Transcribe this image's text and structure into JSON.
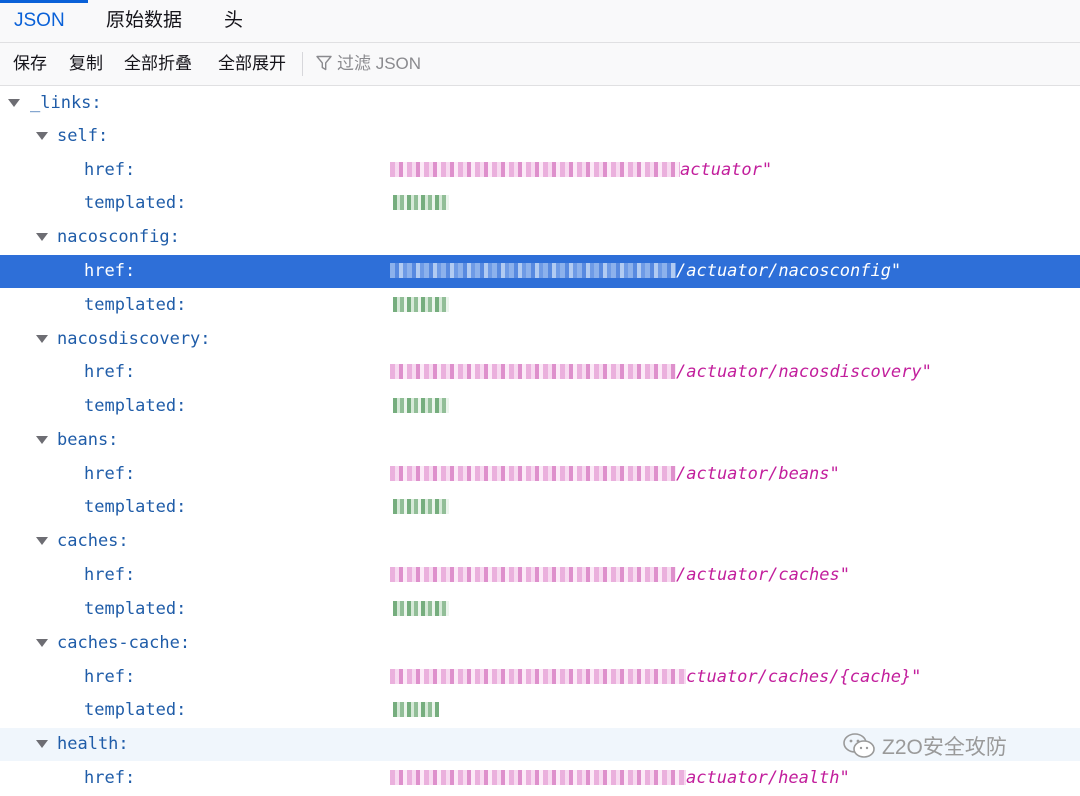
{
  "tabs": [
    {
      "label": "JSON",
      "active": true
    },
    {
      "label": "原始数据",
      "active": false
    },
    {
      "label": "头",
      "active": false
    }
  ],
  "toolbar": {
    "save": "保存",
    "copy": "复制",
    "collapse_all": "全部折叠",
    "expand_all": "全部展开",
    "filter_placeholder": "过滤 JSON"
  },
  "tree": {
    "root_key": "_links:",
    "groups": [
      {
        "key": "self:",
        "href_key": "href:",
        "href_value": "actuator\"",
        "templated_key": "templated:"
      },
      {
        "key": "nacosconfig:",
        "href_key": "href:",
        "href_value": "/actuator/nacosconfig\"",
        "templated_key": "templated:"
      },
      {
        "key": "nacosdiscovery:",
        "href_key": "href:",
        "href_value": "/actuator/nacosdiscovery\"",
        "templated_key": "templated:"
      },
      {
        "key": "beans:",
        "href_key": "href:",
        "href_value": "/actuator/beans\"",
        "templated_key": "templated:"
      },
      {
        "key": "caches:",
        "href_key": "href:",
        "href_value": "/actuator/caches\"",
        "templated_key": "templated:"
      },
      {
        "key": "caches-cache:",
        "href_key": "href:",
        "href_value": "ctuator/caches/{cache}\"",
        "templated_key": "templated:"
      },
      {
        "key": "health:",
        "href_key": "href:",
        "href_value": "actuator/health\""
      }
    ]
  },
  "watermark": "Z2O安全攻防",
  "colors": {
    "accent": "#0a61d8",
    "selection": "#2e6fd8",
    "key": "#1f5ca8",
    "string": "#c21e9c"
  }
}
